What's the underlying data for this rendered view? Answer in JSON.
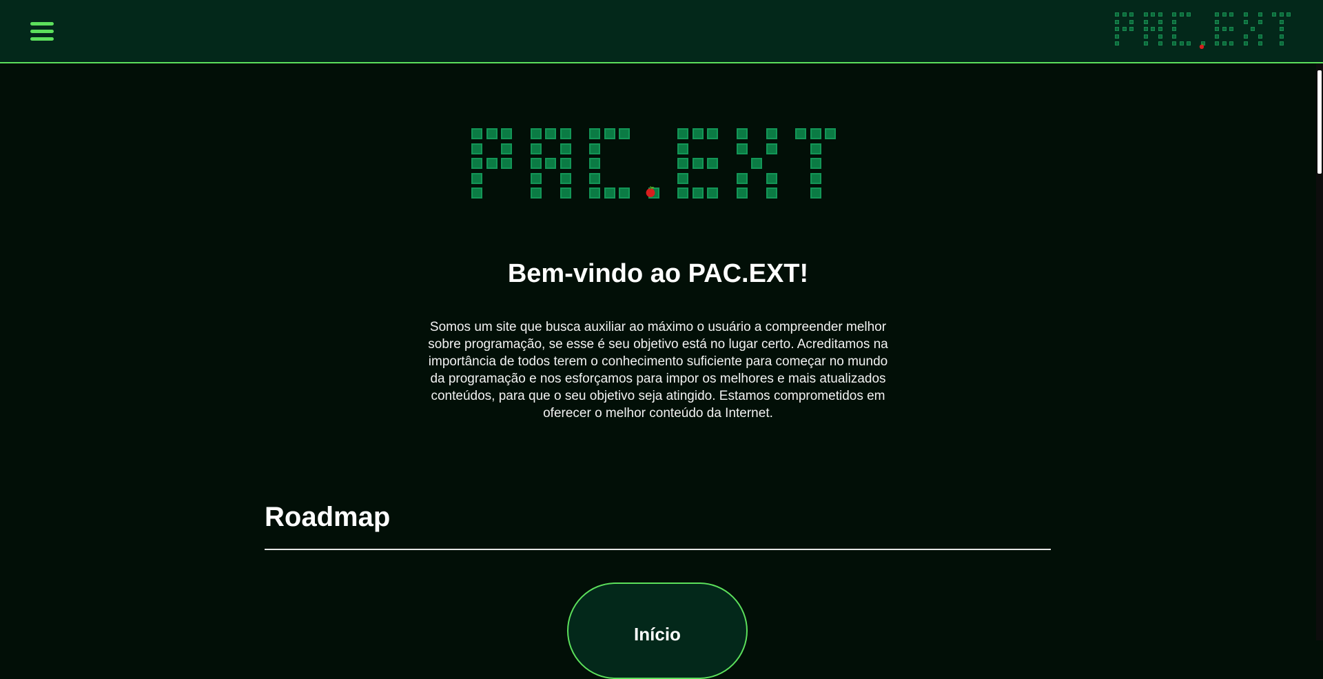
{
  "header": {
    "menu_icon": "hamburger-menu-icon",
    "logo_text": "PAC.EXT",
    "accent_color": "#5ce05c"
  },
  "hero": {
    "logo_text": "PAC.EXT",
    "logo_pixel_color": "#0b7b44",
    "apple_icon": "apple-icon",
    "title": "Bem-vindo ao PAC.EXT!",
    "intro": "Somos um site que busca auxiliar ao máximo o usuário a compreender melhor sobre programação, se esse é seu objetivo está no lugar certo. Acreditamos na importância de todos terem o conhecimento suficiente para começar no mundo da programação e nos esforçamos para impor os melhores e mais atualizados conteúdos, para que o seu objetivo seja atingido. Estamos comprometidos em oferecer o melhor conteúdo da Internet."
  },
  "roadmap": {
    "title": "Roadmap",
    "start_label": "Início"
  }
}
